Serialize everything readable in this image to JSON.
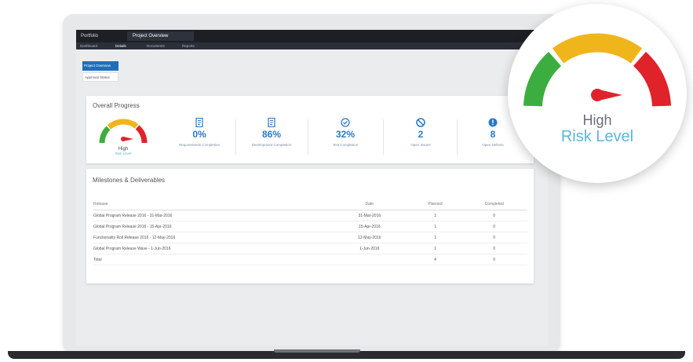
{
  "app": {
    "tab_title": "Portfolio",
    "tab_active": "Project Overview",
    "subtabs": [
      "Dashboard",
      "Details",
      "Documents",
      "Reports"
    ]
  },
  "sidebar": {
    "primary_button": "Project Overview",
    "secondary_button": "Approval Status"
  },
  "overall_progress": {
    "title": "Overall Progress",
    "gauge": {
      "label": "High",
      "sublabel": "Risk Level"
    },
    "stats": [
      {
        "icon": "document-list-icon",
        "value": "0%",
        "label": "Requirements Completion"
      },
      {
        "icon": "document-list-icon",
        "value": "86%",
        "label": "Development Completion"
      },
      {
        "icon": "check-circle-icon",
        "value": "32%",
        "label": "Test Completion"
      },
      {
        "icon": "blocked-icon",
        "value": "2",
        "label": "Open Issues"
      },
      {
        "icon": "alert-circle-icon",
        "value": "8",
        "label": "Open Defects"
      }
    ]
  },
  "milestones": {
    "title": "Milestones & Deliverables",
    "columns": [
      "Release",
      "Date",
      "Planned",
      "Completed"
    ],
    "rows": [
      {
        "release": "Global Program Release 2016 - 31-Mar-2016",
        "date": "31-Mar-2016",
        "planned": "1",
        "completed": "0"
      },
      {
        "release": "Global Program Release 2016 - 15-Apr-2016",
        "date": "15-Apr-2016",
        "planned": "1",
        "completed": "0"
      },
      {
        "release": "Functionality Roll Release 2016 - 12-May-2016",
        "date": "12-May-2016",
        "planned": "1",
        "completed": "0"
      },
      {
        "release": "Global Program Release Wave - 1-Jun-2016",
        "date": "1-Jun-2016",
        "planned": "1",
        "completed": "0"
      }
    ],
    "total": {
      "label": "Total",
      "planned": "4",
      "completed": "0"
    }
  },
  "magnifier": {
    "label": "High",
    "sublabel": "Risk Level"
  },
  "colors": {
    "accent": "#2a79c6",
    "gauge_green": "#3cae3f",
    "gauge_yellow": "#f1b51c",
    "gauge_red": "#e0222b"
  }
}
